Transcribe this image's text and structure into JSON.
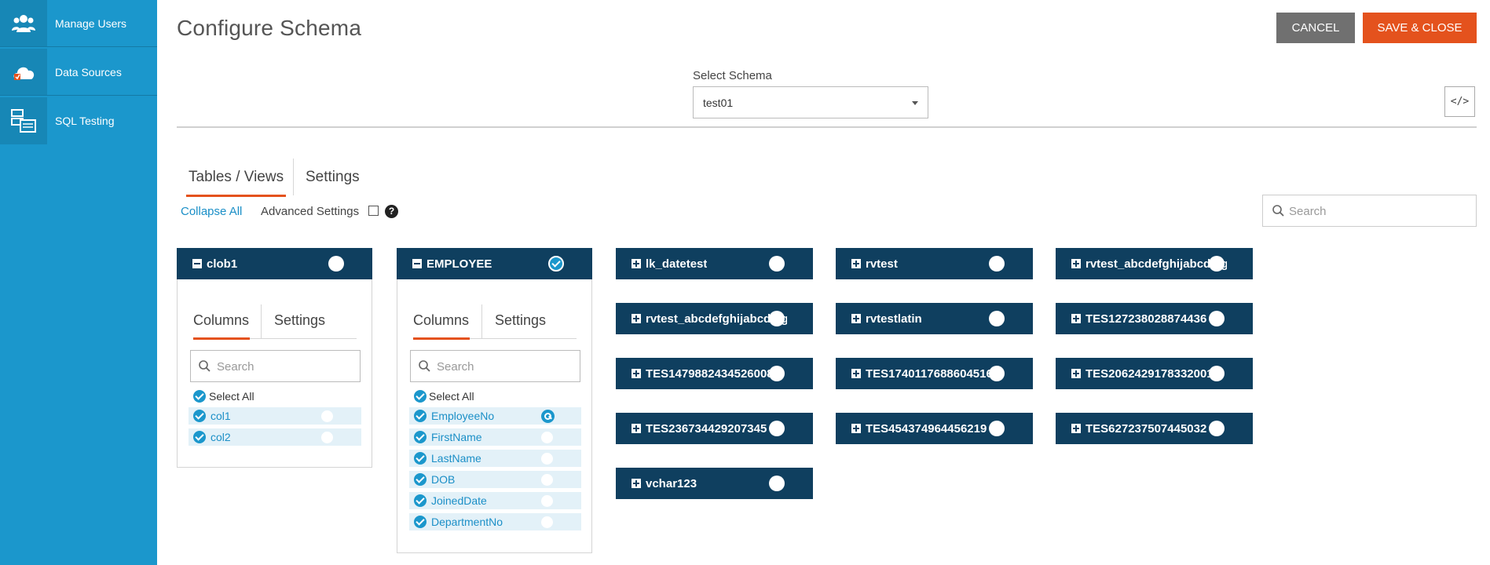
{
  "sidebar": {
    "items": [
      {
        "label": "Manage Users",
        "icon": "users-icon"
      },
      {
        "label": "Data Sources",
        "icon": "cloud-icon"
      },
      {
        "label": "SQL Testing",
        "icon": "sql-testing-icon"
      }
    ]
  },
  "header": {
    "title": "Configure Schema",
    "cancel_label": "CANCEL",
    "save_label": "SAVE & CLOSE"
  },
  "schema": {
    "label": "Select Schema",
    "value": "test01"
  },
  "code_button": {
    "icon": "code-icon",
    "glyph": "</>"
  },
  "tabs": [
    {
      "label": "Tables / Views",
      "active": true
    },
    {
      "label": "Settings",
      "active": false
    }
  ],
  "toolbar": {
    "collapse_all": "Collapse All",
    "advanced_settings": "Advanced Settings",
    "help": "?"
  },
  "search": {
    "placeholder": "Search"
  },
  "expanded_tables": [
    {
      "name": "clob1",
      "selected": false,
      "tabs": [
        "Columns",
        "Settings"
      ],
      "search_placeholder": "Search",
      "select_all": "Select All",
      "columns": [
        {
          "name": "col1",
          "key": false
        },
        {
          "name": "col2",
          "key": false
        }
      ]
    },
    {
      "name": "EMPLOYEE",
      "selected": true,
      "tabs": [
        "Columns",
        "Settings"
      ],
      "search_placeholder": "Search",
      "select_all": "Select All",
      "columns": [
        {
          "name": "EmployeeNo",
          "key": true
        },
        {
          "name": "FirstName",
          "key": false
        },
        {
          "name": "LastName",
          "key": false
        },
        {
          "name": "DOB",
          "key": false
        },
        {
          "name": "JoinedDate",
          "key": false
        },
        {
          "name": "DepartmentNo",
          "key": false
        }
      ]
    }
  ],
  "collapsed_tables": [
    "lk_datetest",
    "rvtest",
    "rvtest_abcdefghijabcdefg",
    "rvtest_abcdefghijabcdefg",
    "rvtestlatin",
    "TES127238028874436",
    "TES1479882434526008",
    "TES1740117688604516",
    "TES2062429178332001",
    "TES236734429207345",
    "TES454374964456219",
    "TES627237507445032",
    "vchar123"
  ],
  "colors": {
    "sidebar": "#1b97cc",
    "table_header": "#0f3f5f",
    "accent": "#e4521d",
    "cancel": "#707070",
    "link": "#1b8fc7"
  }
}
